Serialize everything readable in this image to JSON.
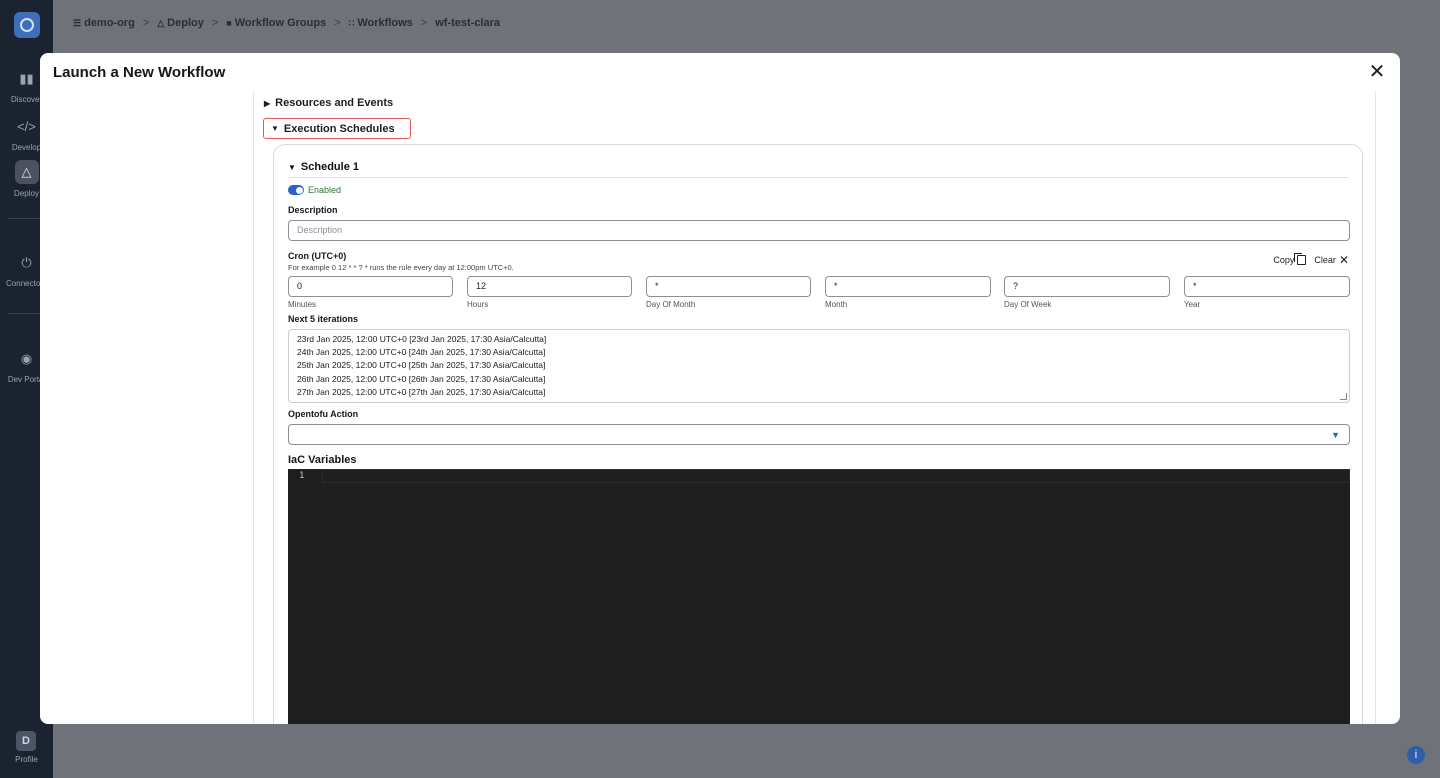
{
  "app": {
    "logo_icon": "target-logo-icon",
    "nav": [
      {
        "label": "Discover",
        "icon": "bar-chart-icon"
      },
      {
        "label": "Develop",
        "icon": "code-icon"
      },
      {
        "label": "Deploy",
        "icon": "deploy-icon",
        "active": true
      },
      {
        "label": "Connectors",
        "icon": "plug-icon"
      },
      {
        "label": "Dev Portal",
        "icon": "portal-icon"
      }
    ],
    "profile": {
      "initial": "D",
      "label": "Profile"
    },
    "breadcrumb": [
      "demo-org",
      "Deploy",
      "Workflow Groups",
      "Workflows",
      "wf-test-clara"
    ]
  },
  "modal": {
    "title": "Launch a New Workflow",
    "sections": {
      "resources": "Resources and Events",
      "execution": "Execution Schedules"
    },
    "schedule": {
      "title": "Schedule 1",
      "enabled_label": "Enabled",
      "enabled": true,
      "description_label": "Description",
      "description_placeholder": "Description",
      "cron_label": "Cron (UTC+0)",
      "cron_hint": "For example 0 12 * * ? * runs the rule every day at 12:00pm UTC+0.",
      "copy_label": "Copy",
      "clear_label": "Clear",
      "cron_fields": [
        {
          "value": "0",
          "label": "Minutes"
        },
        {
          "value": "12",
          "label": "Hours"
        },
        {
          "value": "*",
          "label": "Day Of Month"
        },
        {
          "value": "*",
          "label": "Month"
        },
        {
          "value": "?",
          "label": "Day Of Week"
        },
        {
          "value": "*",
          "label": "Year"
        }
      ],
      "iterations_label": "Next 5 iterations",
      "iterations": [
        "23rd Jan 2025, 12:00 UTC+0 [23rd Jan 2025, 17:30 Asia/Calcutta]",
        "24th Jan 2025, 12:00 UTC+0 [24th Jan 2025, 17:30 Asia/Calcutta]",
        "25th Jan 2025, 12:00 UTC+0 [25th Jan 2025, 17:30 Asia/Calcutta]",
        "26th Jan 2025, 12:00 UTC+0 [26th Jan 2025, 17:30 Asia/Calcutta]",
        "27th Jan 2025, 12:00 UTC+0 [27th Jan 2025, 17:30 Asia/Calcutta]"
      ],
      "action_label": "Opentofu Action",
      "action_value": "",
      "iac_label": "IaC Variables",
      "editor_line": "1"
    }
  },
  "colors": {
    "accent": "#2b63c5",
    "highlight_border": "#e25a5a",
    "enabled_text": "#2d7a3a",
    "editor_bg": "#1e1e1e"
  }
}
